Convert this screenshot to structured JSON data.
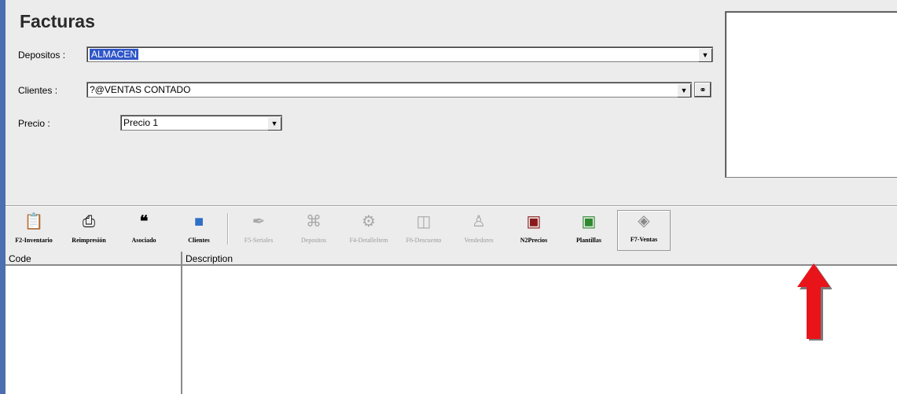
{
  "form": {
    "title": "Facturas",
    "depositos": {
      "label": "Depositos :",
      "value": "ALMACEN"
    },
    "clientes": {
      "label": "Clientes :",
      "value": "?@VENTAS CONTADO"
    },
    "precio": {
      "label": "Precio :",
      "value": "Precio 1"
    }
  },
  "toolbar": {
    "buttons": [
      {
        "label": "F2-Inventario",
        "icon": "clipboard-icon",
        "enabled": true
      },
      {
        "label": "Reimpresión",
        "icon": "printer-icon",
        "enabled": true
      },
      {
        "label": "Asociado",
        "icon": "users-icon",
        "enabled": true
      },
      {
        "label": "Clientes",
        "icon": "clients-icon",
        "enabled": true
      },
      {
        "label": "F5-Seriales",
        "icon": "tag-icon",
        "enabled": false
      },
      {
        "label": "Depositos",
        "icon": "warehouse-icon",
        "enabled": false
      },
      {
        "label": "F4-DetalleItem",
        "icon": "detail-icon",
        "enabled": false
      },
      {
        "label": "F6-Descuento",
        "icon": "discount-icon",
        "enabled": false
      },
      {
        "label": "Vendedores",
        "icon": "seller-icon",
        "enabled": false
      },
      {
        "label": "N2Precios",
        "icon": "price-book-icon",
        "enabled": true
      },
      {
        "label": "Plantillas",
        "icon": "template-icon",
        "enabled": true
      },
      {
        "label": "F7-Ventas",
        "icon": "sales-icon",
        "enabled": true
      }
    ]
  },
  "grid": {
    "columns": [
      "Code",
      "Description"
    ]
  },
  "colors": {
    "panel": "#ececec",
    "selection": "#2f56c8",
    "left_bar": "#4b6fb0",
    "annotation_arrow": "#e8141a"
  }
}
